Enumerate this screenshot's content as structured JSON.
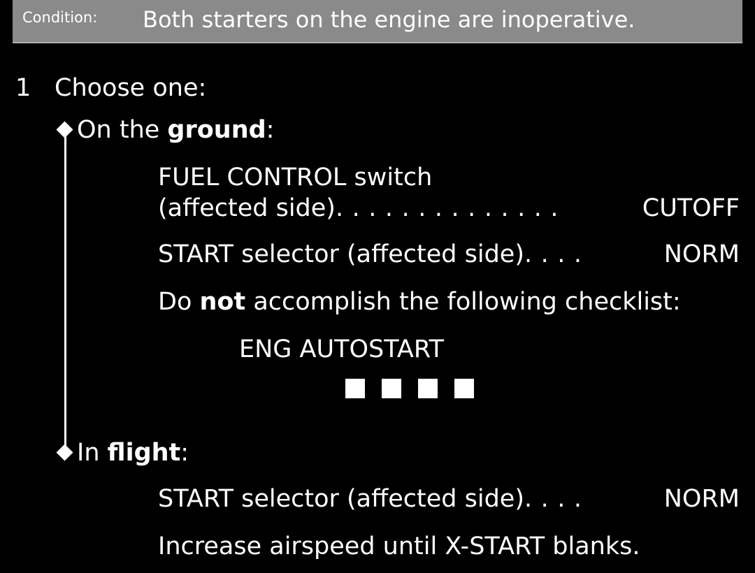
{
  "condition": {
    "label": "Condition:",
    "text": "Both starters on the engine are inoperative."
  },
  "step": {
    "number": "1",
    "title": "Choose one:"
  },
  "ground": {
    "prefix": "On the ",
    "bold": "ground",
    "suffix": ":",
    "fuel_control_line1": "FUEL CONTROL switch",
    "fuel_control_line2": "(affected side)",
    "fuel_control_dots": ". . . . . . . . . . . . . .",
    "fuel_control_value": "CUTOFF",
    "start_selector_label": "START selector (affected side)",
    "start_selector_dots": ". . . .",
    "start_selector_value": "NORM",
    "do_not_prefix": "Do ",
    "do_not_bold": "not",
    "do_not_suffix": " accomplish the following checklist:",
    "checklist_name": "ENG AUTOSTART"
  },
  "flight": {
    "prefix": "In ",
    "bold": "flight",
    "suffix": ":",
    "start_selector_label": "START selector (affected side)",
    "start_selector_dots": ". . . .",
    "start_selector_value": "NORM",
    "airspeed_text": "Increase airspeed until X-START blanks."
  },
  "icons": {
    "branch_marker": "diamond-icon",
    "end_marker": "end-of-checklist-squares-icon"
  },
  "colors": {
    "background": "#000000",
    "text": "#ffffff",
    "condition_bar": "#8a8a8a"
  }
}
